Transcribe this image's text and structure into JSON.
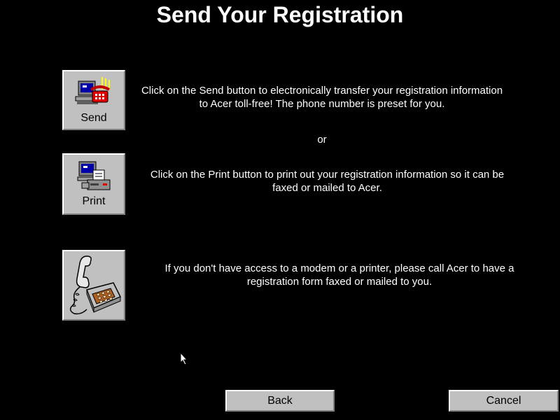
{
  "title": "Send Your Registration",
  "options": {
    "send": {
      "button_label": "Send",
      "icon": "computer-phone-icon",
      "description": "Click on the Send button to electronically transfer your registration information to Acer toll-free!  The phone number is preset for you."
    },
    "or_text": "or",
    "print": {
      "button_label": "Print",
      "icon": "computer-printer-icon",
      "description": "Click on the Print button to print out your registration information so it can be faxed or mailed to Acer."
    },
    "phone": {
      "icon": "telephone-icon",
      "description": "If you don't have access to a modem or a printer, please call Acer to have a registration form faxed or mailed to you."
    }
  },
  "footer": {
    "back_label": "Back",
    "cancel_label": "Cancel"
  },
  "colors": {
    "background": "#000000",
    "button_face": "#c0c0c0",
    "text": "#ffffff"
  }
}
